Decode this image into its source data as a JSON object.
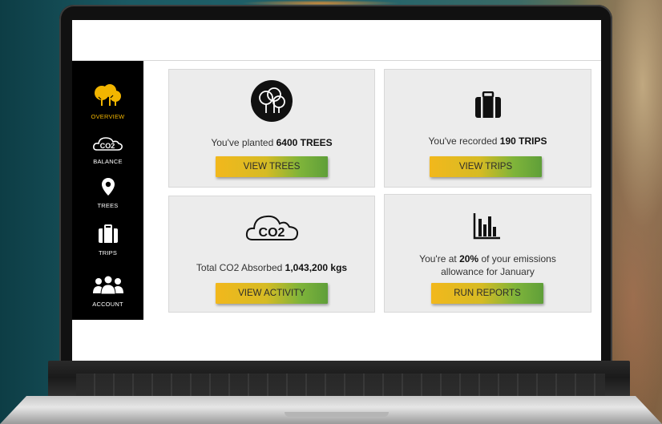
{
  "sidebar": {
    "items": [
      {
        "label": "OVERVIEW",
        "icon": "trees-icon",
        "active": true
      },
      {
        "label": "BALANCE",
        "icon": "co2-cloud-icon",
        "active": false
      },
      {
        "label": "TREES",
        "icon": "map-pin-icon",
        "active": false
      },
      {
        "label": "TRIPS",
        "icon": "suitcase-icon",
        "active": false
      },
      {
        "label": "ACCOUNT",
        "icon": "users-icon",
        "active": false
      }
    ]
  },
  "cards": {
    "trees": {
      "prefix": "You've planted",
      "value": "6400 TREES",
      "button": "VIEW TREES",
      "icon": "trees-circle-icon"
    },
    "trips": {
      "prefix": "You've recorded",
      "value": "190 TRIPS",
      "button": "VIEW TRIPS",
      "icon": "suitcase-icon"
    },
    "activity": {
      "prefix": "Total CO2 Absorbed",
      "value": "1,043,200 kgs",
      "button": "VIEW ACTIVITY",
      "icon": "co2-cloud-icon",
      "icon_text": "CO2"
    },
    "reports": {
      "prefix": "You're at",
      "value": "20%",
      "suffix": "of your emissions",
      "line2": "allowance for January",
      "button": "RUN REPORTS",
      "icon": "bar-chart-icon"
    }
  },
  "colors": {
    "accent": "#f2b500",
    "button_start": "#f2b81c",
    "button_end": "#5f9f39",
    "sidebar": "#000000",
    "card_bg": "#ececec"
  }
}
